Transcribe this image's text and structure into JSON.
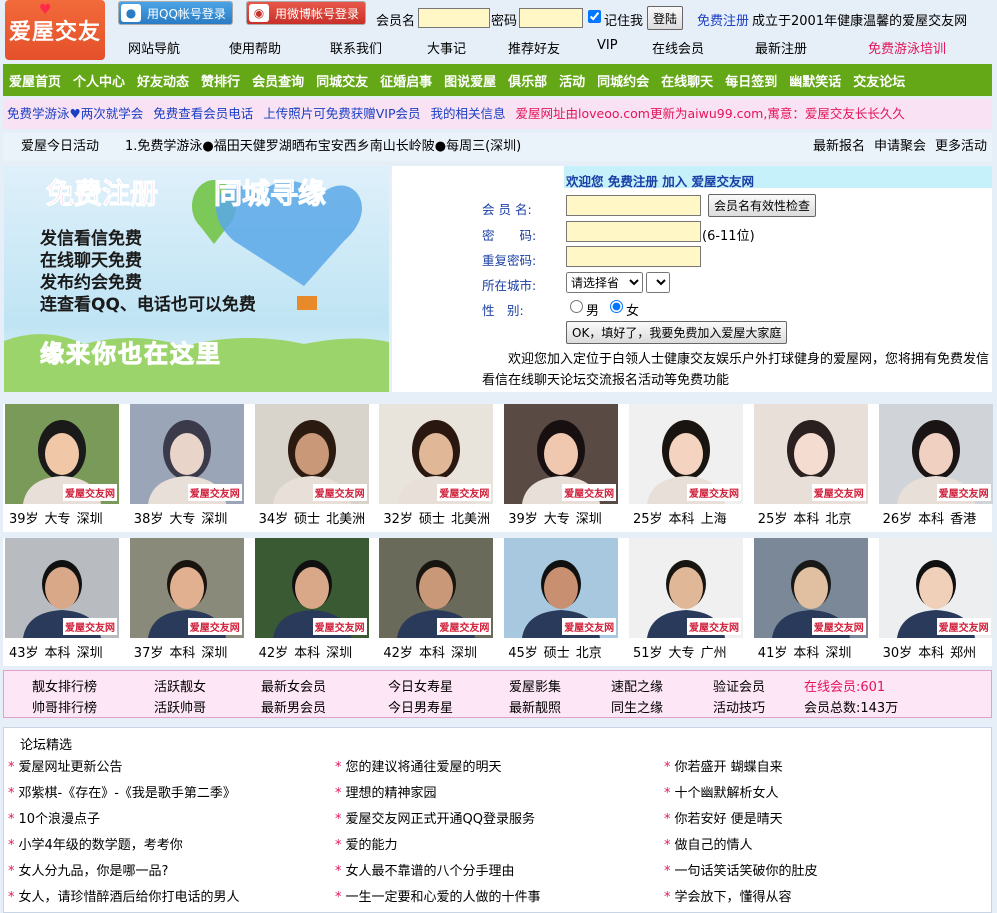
{
  "logo": {
    "text": "爱屋交友"
  },
  "top": {
    "qq_login": "用QQ帐号登录",
    "weibo_login": "用微博帐号登录",
    "user_label": "会员名",
    "pass_label": "密码",
    "remember": "记住我",
    "login_btn": "登陆",
    "register_link": "免费注册",
    "slogan": "成立于2001年健康温馨的爱屋交友网"
  },
  "topnav": [
    "网站导航",
    "使用帮助",
    "联系我们",
    "大事记",
    "推荐好友",
    "VIP",
    "在线会员",
    "最新注册",
    "免费游泳培训"
  ],
  "mainnav": [
    "爱屋首页",
    "个人中心",
    "好友动态",
    "赞排行",
    "会员查询",
    "同城交友",
    "征婚启事",
    "图说爱屋",
    "俱乐部",
    "活动",
    "同城约会",
    "在线聊天",
    "每日签到",
    "幽默笑话",
    "交友论坛"
  ],
  "ticker": [
    {
      "t": "免费学游泳♥两次就学会",
      "red": false
    },
    {
      "t": "免费查看会员电话",
      "red": false
    },
    {
      "t": "上传照片可免费获赠VIP会员",
      "red": false
    },
    {
      "t": "我的相关信息",
      "red": false
    },
    {
      "t": "爱屋网址由loveoo.com更新为aiwu99.com,寓意：爱屋交友长长久久",
      "red": true
    }
  ],
  "activity": {
    "label": "爱屋今日活动",
    "text": "1.免费学游泳●福田天健罗湖晒布宝安西乡南山长岭陂●每周三(深圳)",
    "right": [
      "最新报名",
      "申请聚会",
      "更多活动"
    ]
  },
  "banner": {
    "title1": "免费注册",
    "title2": "同城寻缘",
    "lines": [
      "发信看信免费",
      "在线聊天免费",
      "发布约会免费",
      "连查看QQ、电话也可以免费"
    ],
    "footer": "缘来你也在这里"
  },
  "register": {
    "welcome": "欢迎您 免费注册 加入 爱屋交友网",
    "username_label": "会 员 名:",
    "check_btn": "会员名有效性检查",
    "password_label": "密　　码:",
    "password_hint": "(6-11位)",
    "repeat_label": "重复密码:",
    "city_label": "所在城市:",
    "province_placeholder": "请选择省",
    "gender_label": "性　别:",
    "male": "男",
    "female": "女",
    "selected_gender": "女",
    "submit": "OK，填好了，我要免费加入爱屋大家庭",
    "intro": "欢迎您加入定位于白领人士健康交友娱乐户外打球健身的爱屋网，您将拥有免费发信看信在线聊天论坛交流报名活动等免费功能"
  },
  "watermark": "爱屋交友网",
  "women": [
    {
      "age": "39岁",
      "edu": "大专",
      "city": "深圳",
      "bg": "#7a9a5a",
      "skin": "#f0c8a8",
      "hair": "#1a1a1a"
    },
    {
      "age": "38岁",
      "edu": "大专",
      "city": "深圳",
      "bg": "#9aa6b8",
      "skin": "#e8d4c8",
      "hair": "#3a3a4a"
    },
    {
      "age": "34岁",
      "edu": "硕士",
      "city": "北美洲",
      "bg": "#d8d4cc",
      "skin": "#c89878",
      "hair": "#2a1a10"
    },
    {
      "age": "32岁",
      "edu": "硕士",
      "city": "北美洲",
      "bg": "#e8e4dc",
      "skin": "#e0b898",
      "hair": "#2a1810"
    },
    {
      "age": "39岁",
      "edu": "大专",
      "city": "深圳",
      "bg": "#5a4a44",
      "skin": "#f0c8b0",
      "hair": "#181010"
    },
    {
      "age": "25岁",
      "edu": "本科",
      "city": "上海",
      "bg": "#f0f0f0",
      "skin": "#f4d4c0",
      "hair": "#1a1410"
    },
    {
      "age": "25岁",
      "edu": "本科",
      "city": "北京",
      "bg": "#e8e0d8",
      "skin": "#f4dcd0",
      "hair": "#2a2020"
    },
    {
      "age": "26岁",
      "edu": "本科",
      "city": "香港",
      "bg": "#d0d4d8",
      "skin": "#f0d0c0",
      "hair": "#1a1414"
    }
  ],
  "men": [
    {
      "age": "43岁",
      "edu": "本科",
      "city": "深圳",
      "bg": "#b8bcc0",
      "skin": "#d8a888",
      "hair": "#101010"
    },
    {
      "age": "37岁",
      "edu": "本科",
      "city": "深圳",
      "bg": "#8a8a7a",
      "skin": "#e0b090",
      "hair": "#1a1410"
    },
    {
      "age": "42岁",
      "edu": "本科",
      "city": "深圳",
      "bg": "#3a5a34",
      "skin": "#d8a888",
      "hair": "#101010"
    },
    {
      "age": "42岁",
      "edu": "本科",
      "city": "深圳",
      "bg": "#6a6a5a",
      "skin": "#c89878",
      "hair": "#181410"
    },
    {
      "age": "45岁",
      "edu": "硕士",
      "city": "北京",
      "bg": "#a8c8e0",
      "skin": "#c89070",
      "hair": "#101010"
    },
    {
      "age": "51岁",
      "edu": "大专",
      "city": "广州",
      "bg": "#f0f0f0",
      "skin": "#e0b898",
      "hair": "#181410"
    },
    {
      "age": "41岁",
      "edu": "本科",
      "city": "深圳",
      "bg": "#7a8898",
      "skin": "#e0c0a0",
      "hair": "#181818"
    },
    {
      "age": "30岁",
      "edu": "本科",
      "city": "郑州",
      "bg": "#eceef0",
      "skin": "#f0d0b8",
      "hair": "#101010"
    }
  ],
  "rank": {
    "row1": [
      "靓女排行榜",
      "活跃靓女",
      "最新女会员",
      "今日女寿星",
      "爱屋影集",
      "速配之缘",
      "验证会员",
      "在线会员:601"
    ],
    "row2": [
      "帅哥排行榜",
      "活跃帅哥",
      "最新男会员",
      "今日男寿星",
      "最新靓照",
      "同生之缘",
      "活动技巧",
      "会员总数:143万"
    ]
  },
  "forum": {
    "title": "论坛精选",
    "col1": [
      "爱屋网址更新公告",
      "邓紫棋-《存在》-《我是歌手第二季》",
      "10个浪漫点子",
      "小学4年级的数学题，考考你",
      "女人分九品，你是哪一品?",
      "女人，请珍惜醉酒后给你打电话的男人"
    ],
    "col2": [
      "您的建议将通往爱屋的明天",
      "理想的精神家园",
      "爱屋交友网正式开通QQ登录服务",
      "爱的能力",
      "女人最不靠谱的八个分手理由",
      "一生一定要和心爱的人做的十件事"
    ],
    "col3": [
      "你若盛开 蝴蝶自来",
      "十个幽默解析女人",
      "你若安好 便是晴天",
      "做自己的情人",
      "一句话笑话笑破你的肚皮",
      "学会放下，懂得从容"
    ]
  },
  "colors": {
    "green": "#64a817",
    "pink": "#f9e2f3",
    "link_blue": "#1a3fc4",
    "red": "#e4145a"
  }
}
